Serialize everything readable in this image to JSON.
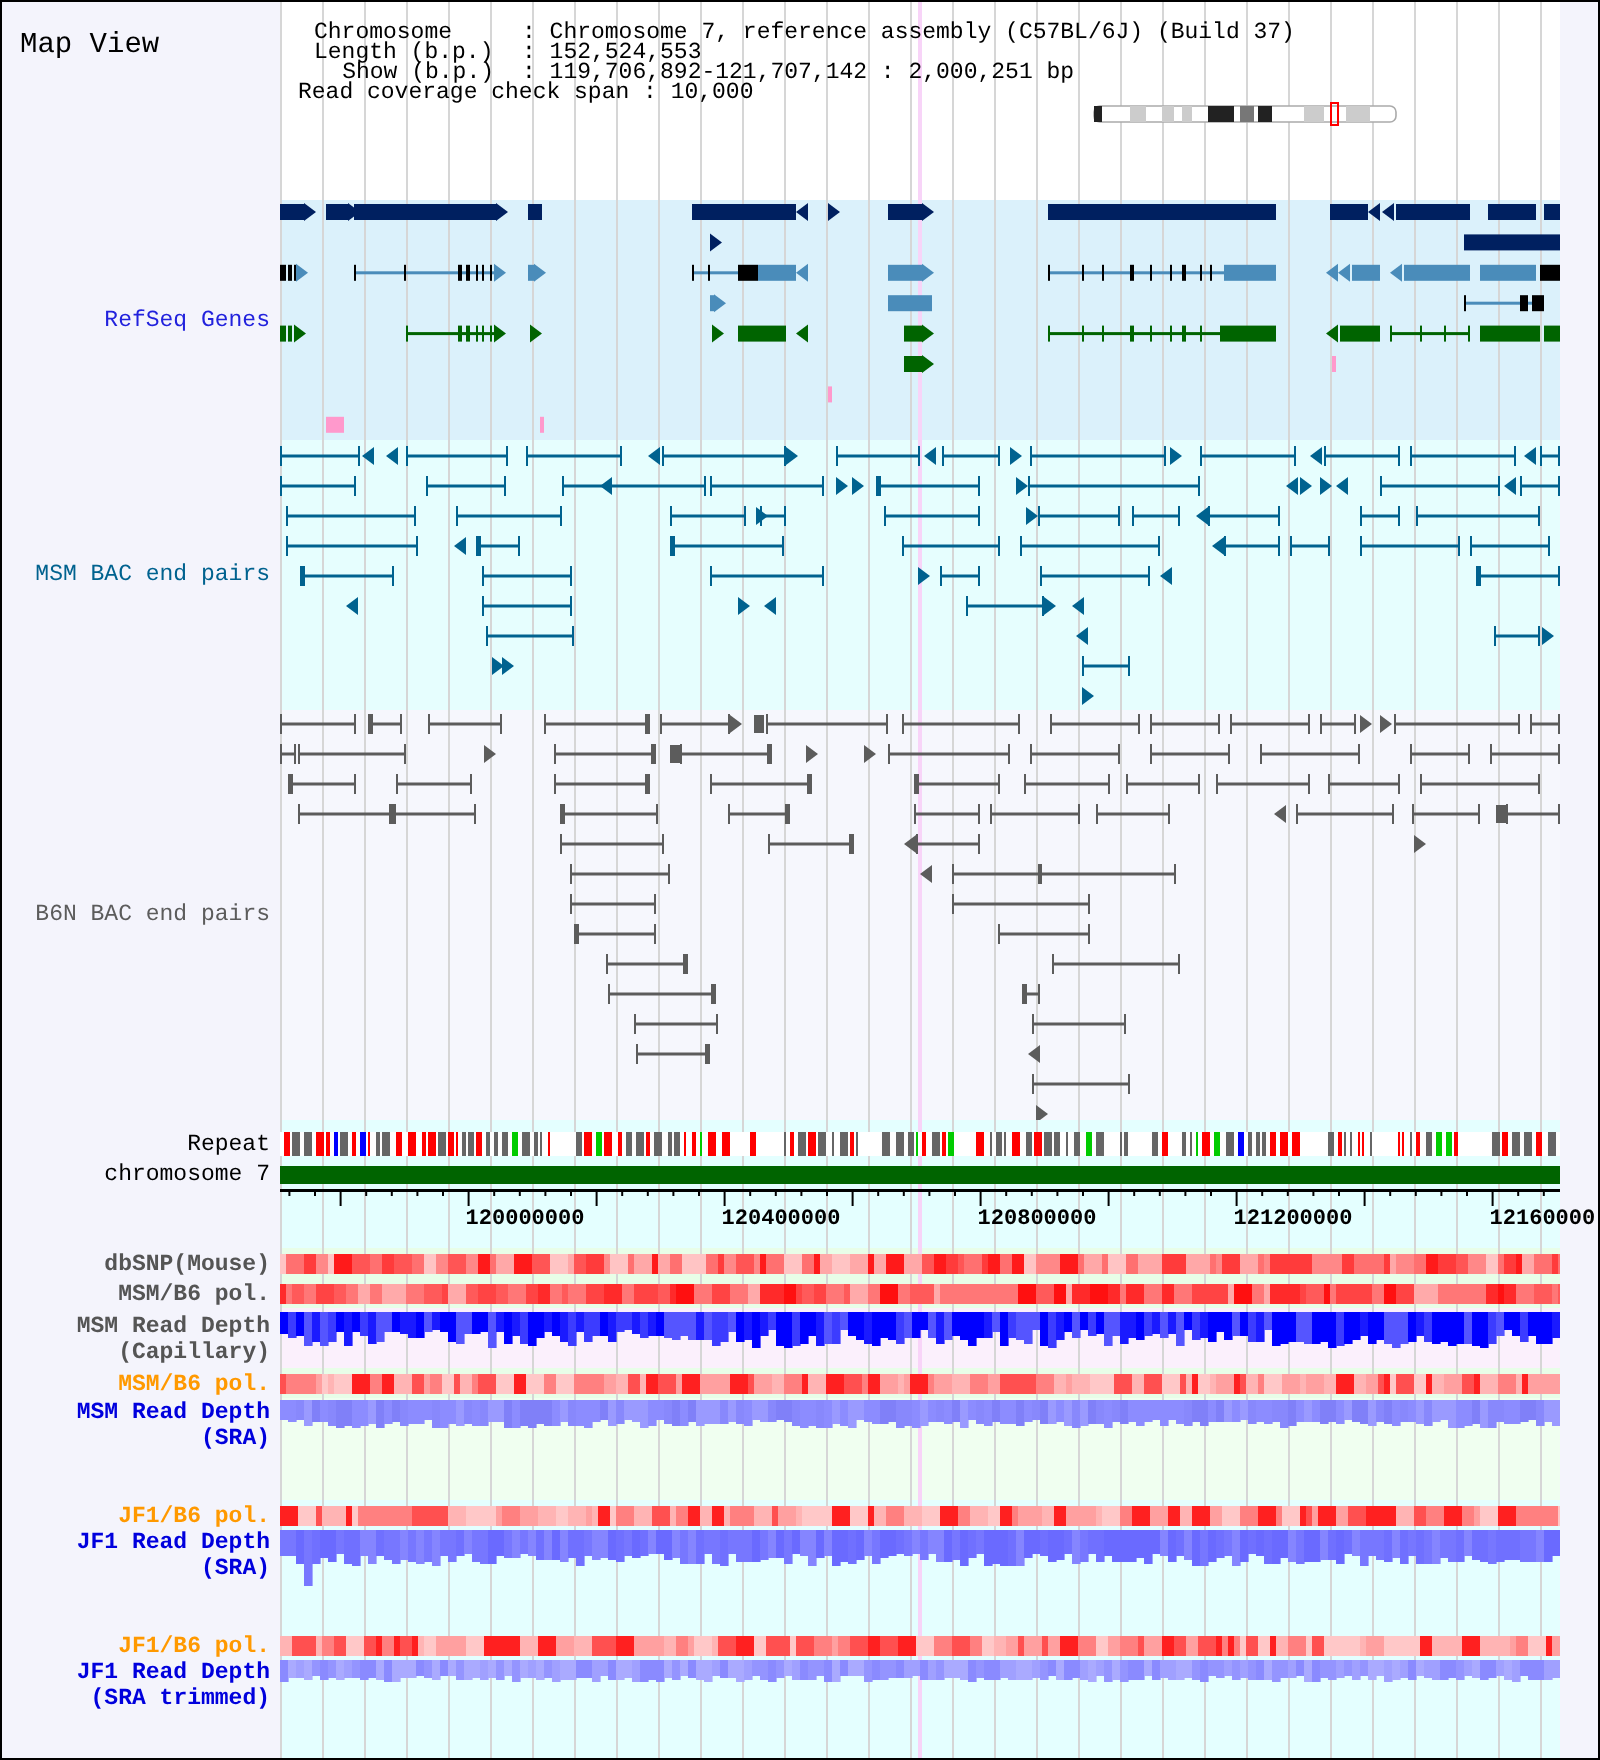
{
  "title": "Map View",
  "info": {
    "rows": [
      {
        "label": "Chromosome",
        "value": ": Chromosome 7, reference assembly (C57BL/6J) (Build 37)"
      },
      {
        "label": "Length (b.p.)",
        "value": ": 152,524,553"
      },
      {
        "label": "Show (b.p.)",
        "value": ": 119,706,892-121,707,142 : 2,000,251 bp"
      }
    ],
    "coverage_span": {
      "text": "Read coverage check span : 10,000"
    }
  },
  "feature_tracks": [
    {
      "kind": "genes",
      "label": "RefSeq Genes",
      "color": "#2222dd"
    },
    {
      "kind": "bac_pairs",
      "label": "MSM BAC end pairs",
      "color": "#00628f"
    },
    {
      "kind": "bac_pairs",
      "label": "B6N BAC end pairs",
      "color": "#5c5c5c"
    }
  ],
  "repeat_track": {
    "label": "Repeat"
  },
  "chromosome_track": {
    "label": "chromosome 7"
  },
  "axis": {
    "labels": [
      "120000000",
      "120400000",
      "120800000",
      "121200000",
      "12160000"
    ]
  },
  "data_tracks": [
    {
      "kind": "variant_strip",
      "label": "dbSNP(Mouse)",
      "color": "#555555"
    },
    {
      "kind": "variant_strip",
      "label": "MSM/B6 pol.",
      "color": "#555555"
    },
    {
      "kind": "read_depth",
      "label": "MSM Read Depth (Capillary)",
      "color": "#555555"
    },
    {
      "kind": "variant_strip",
      "label": "MSM/B6 pol.",
      "color": "#ff9900"
    },
    {
      "kind": "read_depth",
      "label": "MSM Read Depth (SRA)",
      "color": "#0000dd"
    },
    {
      "kind": "variant_strip",
      "label": "JF1/B6 pol.",
      "color": "#ff9900"
    },
    {
      "kind": "read_depth",
      "label": "JF1 Read Depth (SRA)",
      "color": "#0000dd"
    },
    {
      "kind": "variant_strip",
      "label": "JF1/B6 pol.",
      "color": "#ff9900"
    },
    {
      "kind": "read_depth",
      "label": "JF1 Read Depth (SRA trimmed)",
      "color": "#0000dd"
    }
  ]
}
